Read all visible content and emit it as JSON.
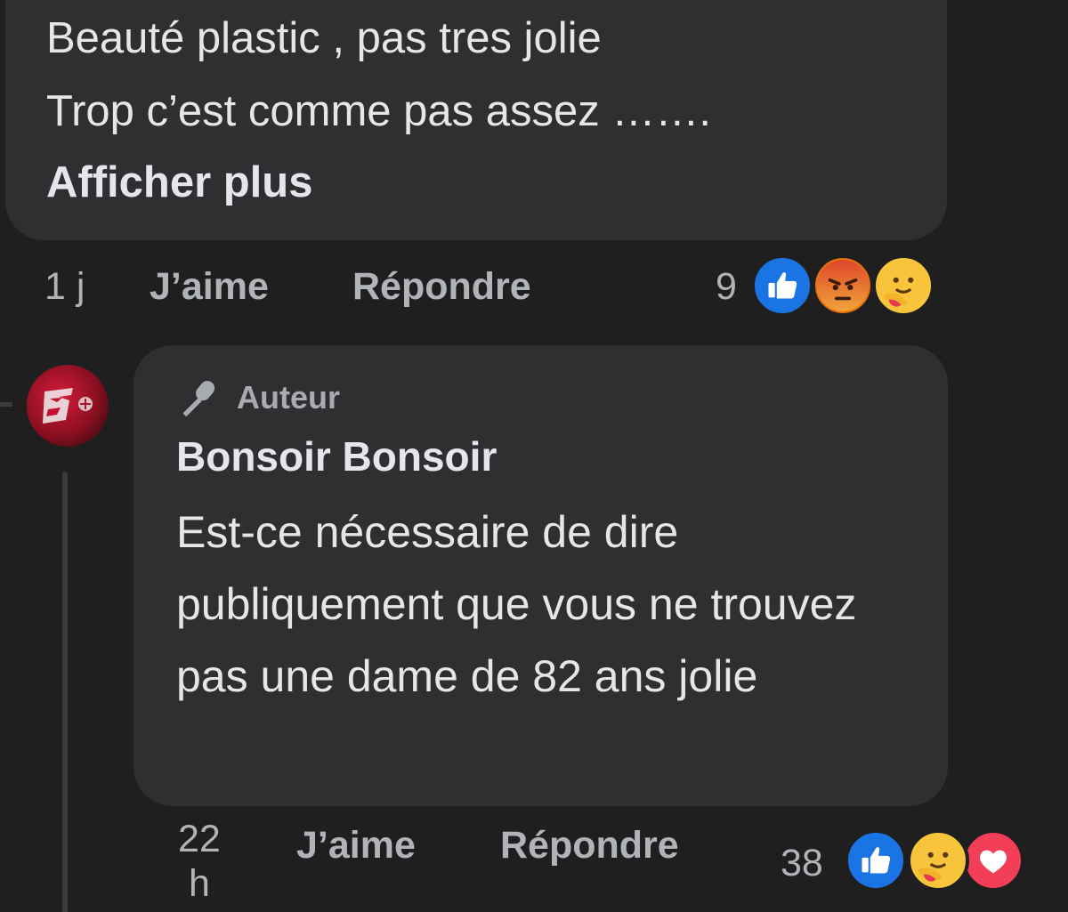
{
  "comment": {
    "lines": [
      "Beauté plastic , pas tres jolie",
      "Trop c’est comme pas assez ……."
    ],
    "see_more": "Afficher plus",
    "time": "1 j",
    "like": "J’aime",
    "reply": "Répondre",
    "reaction_count": "9",
    "reactions": [
      "like-icon",
      "angry-icon",
      "care-icon"
    ]
  },
  "reply": {
    "badge": "Auteur",
    "badge_icon": "microphone-icon",
    "author": "Bonsoir Bonsoir",
    "text": "Est-ce nécessaire de dire publiquement que vous ne trouvez pas une dame de 82 ans jolie",
    "time_line1": "22",
    "time_line2": "h",
    "like": "J’aime",
    "reply": "Répondre",
    "reaction_count": "38",
    "reactions": [
      "like-icon",
      "care-icon",
      "love-icon"
    ]
  },
  "colors": {
    "background": "#1f1f20",
    "bubble": "#2f2f31",
    "muted_text": "#b0b3b8",
    "like_blue": "#1b74e4",
    "love_red": "#f33e58",
    "angry_orange": "#e9710f"
  }
}
